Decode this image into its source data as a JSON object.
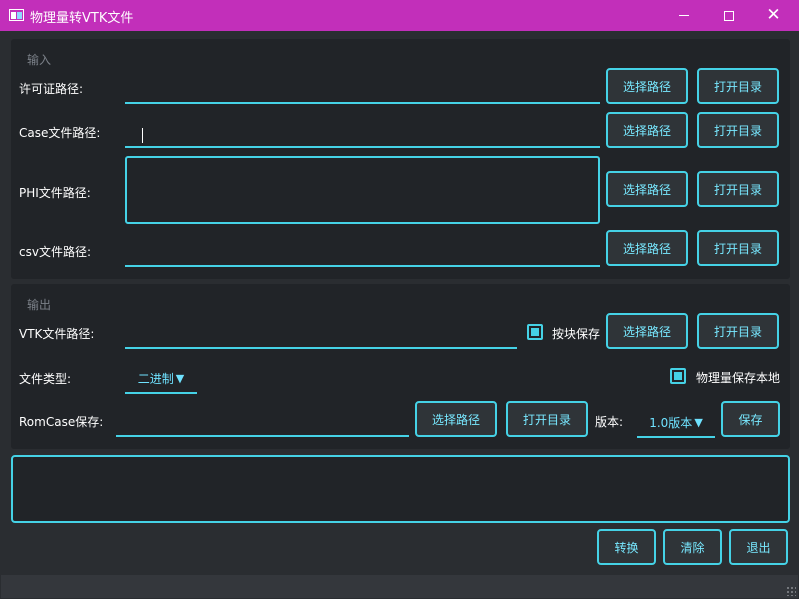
{
  "window": {
    "title": "物理量转VTK文件",
    "controls": [
      "minimize-icon",
      "maximize-icon",
      "close-icon"
    ]
  },
  "input_group": {
    "title": "输入",
    "license": {
      "label": "许可证路径:",
      "value": "",
      "select_label": "选择路径",
      "open_label": "打开目录"
    },
    "case": {
      "label": "Case文件路径:",
      "value": "",
      "select_label": "选择路径",
      "open_label": "打开目录"
    },
    "phi": {
      "label": "PHI文件路径:",
      "value": "",
      "select_label": "选择路径",
      "open_label": "打开目录"
    },
    "csv": {
      "label": "csv文件路径:",
      "value": "",
      "select_label": "选择路径",
      "open_label": "打开目录"
    }
  },
  "output_group": {
    "title": "输出",
    "vtk": {
      "label": "VTK文件路径:",
      "value": "",
      "block_save_label": "按块保存",
      "block_save_checked": true,
      "select_label": "选择路径",
      "open_label": "打开目录"
    },
    "file_type": {
      "label": "文件类型:",
      "selected": "二进制",
      "local_save_label": "物理量保存本地",
      "local_save_checked": true
    },
    "romcase": {
      "label": "RomCase保存:",
      "value": "",
      "select_label": "选择路径",
      "open_label": "打开目录",
      "version_label": "版本:",
      "version_selected": "1.0版本",
      "save_label": "保存"
    }
  },
  "log": {
    "text": ""
  },
  "actions": {
    "convert_label": "转换",
    "clear_label": "清除",
    "exit_label": "退出"
  },
  "colors": {
    "titlebar": "#c22fba",
    "accent": "#45d2e6",
    "panel": "#212428",
    "background": "#2a2d31"
  }
}
